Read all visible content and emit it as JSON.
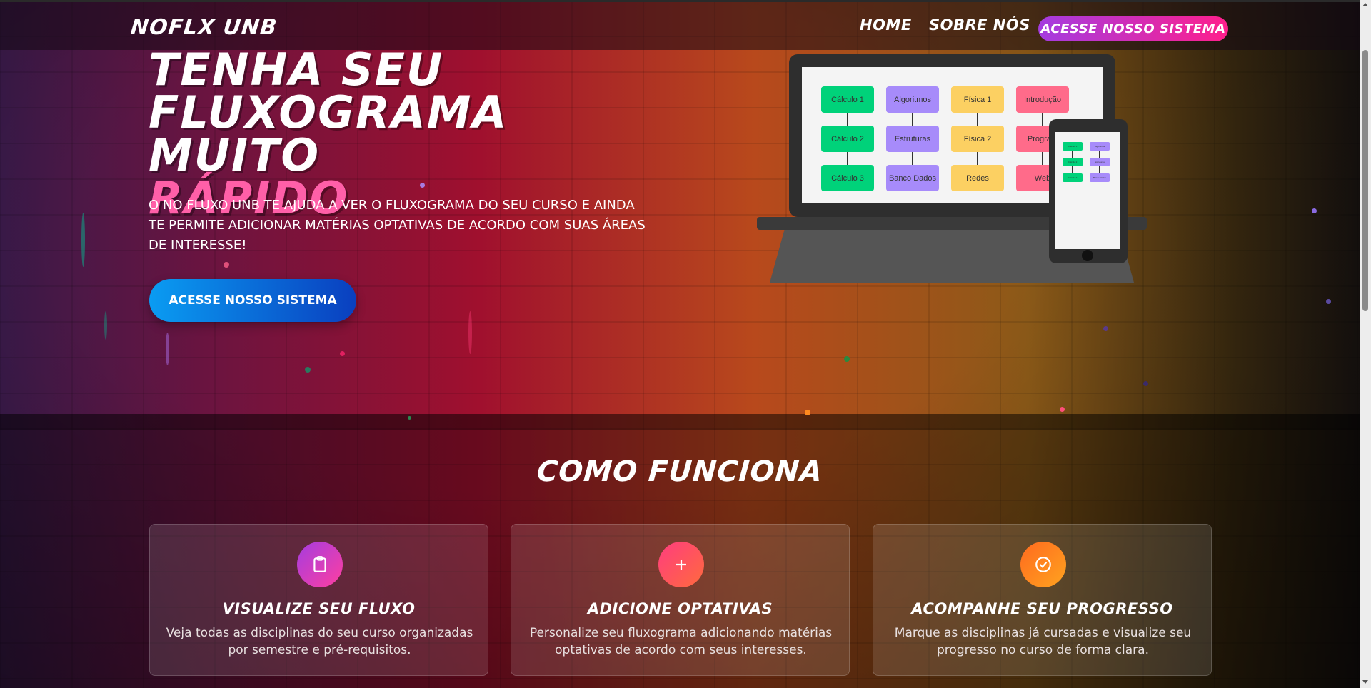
{
  "nav": {
    "brand": "NOFLX UNB",
    "links": [
      "HOME",
      "SOBRE NÓS"
    ],
    "cta": "ACESSE NOSSO SISTEMA"
  },
  "hero": {
    "title_line1": "TENHA SEU",
    "title_line2": "FLUXOGRAMA MUITO",
    "title_accent": "RÁPIDO",
    "description": "O NO FLUXO UNB TE AJUDA A VER O FLUXOGRAMA DO SEU CURSO E AINDA TE PERMITE ADICIONAR MATÉRIAS OPTATIVAS DE ACORDO COM SUAS ÁREAS DE INTERESSE!",
    "cta": "ACESSE NOSSO SISTEMA"
  },
  "flowchart": {
    "columns": [
      [
        "Cálculo 1",
        "Cálculo 2",
        "Cálculo 3"
      ],
      [
        "Algoritmos",
        "Estruturas",
        "Banco Dados"
      ],
      [
        "Física 1",
        "Física 2",
        "Redes"
      ],
      [
        "Introdução",
        "Program",
        "Web"
      ]
    ],
    "column_colors": [
      "#00d27a",
      "#a78bfa",
      "#fcd062",
      "#ff6b8a"
    ],
    "tablet_columns": [
      [
        "Cálculo 1",
        "Cálculo 2",
        "Cálculo 3"
      ],
      [
        "Algoritmos",
        "Estruturas",
        "Banco Dados"
      ]
    ]
  },
  "how_it_works": {
    "title": "COMO FUNCIONA",
    "cards": [
      {
        "icon": "clipboard-icon",
        "title": "VISUALIZE SEU FLUXO",
        "text": "Veja todas as disciplinas do seu curso organizadas por semestre e pré-requisitos."
      },
      {
        "icon": "plus-icon",
        "title": "ADICIONE OPTATIVAS",
        "text": "Personalize seu fluxograma adicionando matérias optativas de acordo com seus interesses."
      },
      {
        "icon": "check-circle-icon",
        "title": "ACOMPANHE SEU PROGRESSO",
        "text": "Marque as disciplinas já cursadas e visualize seu progresso no curso de forma clara."
      }
    ]
  },
  "colors": {
    "nav_cta_gradient": [
      "#a43ce0",
      "#ff1f8c"
    ],
    "hero_cta_gradient": [
      "#0a9cf2",
      "#0a3fbf"
    ],
    "accent": "#ff5fa8",
    "card_icon_gradients": [
      [
        "#a43ce0",
        "#ff3fa0"
      ],
      [
        "#ff3d7f",
        "#ff6a3d"
      ],
      [
        "#ff6a1f",
        "#ffa31f"
      ]
    ]
  }
}
